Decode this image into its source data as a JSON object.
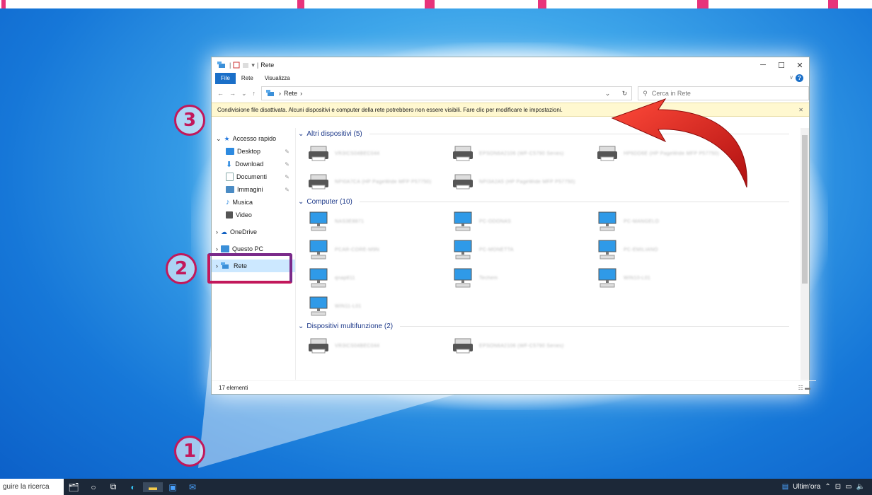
{
  "window": {
    "title": "Rete",
    "tabs": [
      "File",
      "Rete",
      "Visualizza"
    ],
    "address": [
      "Rete"
    ],
    "search_placeholder": "Cerca in Rete",
    "info_bar": "Condivisione file disattivata. Alcuni dispositivi e computer della rete potrebbero non essere visibili. Fare clic per modificare le impostazioni.",
    "status": "17 elementi"
  },
  "sidebar": {
    "quick_access": "Accesso rapido",
    "items": [
      "Desktop",
      "Download",
      "Documenti",
      "Immagini",
      "Musica",
      "Video"
    ],
    "onedrive": "OneDrive",
    "thispc": "Questo PC",
    "network": "Rete"
  },
  "groups": [
    {
      "title": "Altri dispositivi (5)",
      "type": "printer",
      "items": [
        "VR3ICS04BEC044",
        "EPSON6A2106 (WF-C5790 Series)",
        "HP6DD6E (HP PageWide MFP P57750)",
        "NPI0A7CA (HP PageWide MFP P57750)",
        "NPI3A2A5 (HP PageWide MFP P57750)"
      ]
    },
    {
      "title": "Computer (10)",
      "type": "pc",
      "items": [
        "NAS3E8871",
        "PC-ODONAS",
        "PC-MANGELO",
        "PCAR-CORE-M9N",
        "PC-MONETTA",
        "PC-EMILIANO",
        "qnap811",
        "Techem",
        "WIN10-L01",
        "WIN11-L01"
      ]
    },
    {
      "title": "Dispositivi multifunzione (2)",
      "type": "printer",
      "items": [
        "VR3ICS04BEC044",
        "EPSON6A2106 (WF-C5790 Series)"
      ]
    }
  ],
  "annotations": [
    "1",
    "2",
    "3"
  ],
  "taskbar": {
    "search_text": "guire la ricerca",
    "news": "Ultim'ora"
  },
  "colors": {
    "accent": "#1a6fc8",
    "annotation": "#c2185b",
    "info_bg": "#fff8d0"
  }
}
